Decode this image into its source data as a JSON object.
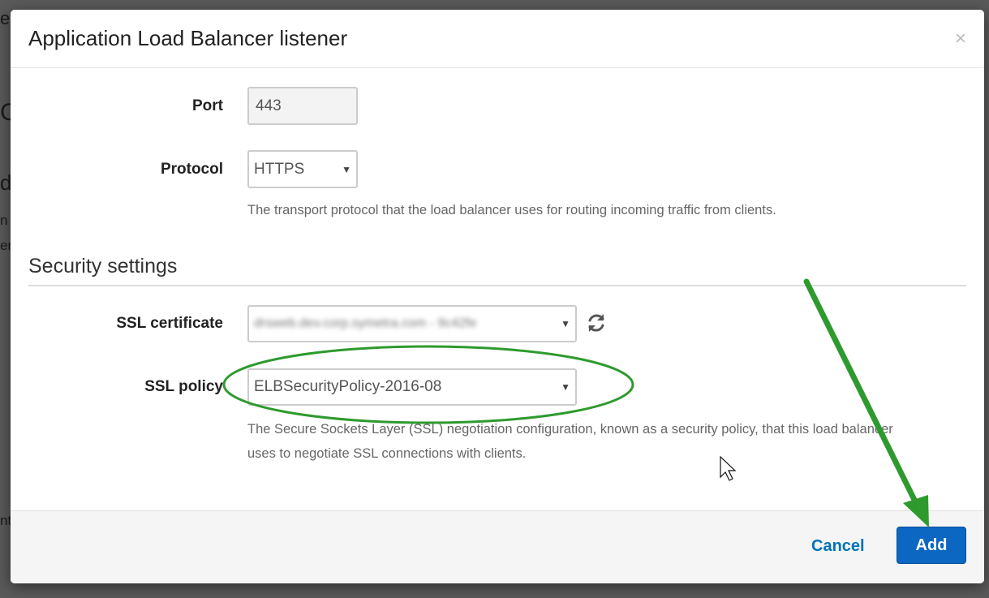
{
  "background": {
    "fragments": [
      "ew",
      "C",
      "d",
      "n",
      "er",
      "nt"
    ]
  },
  "modal": {
    "title": "Application Load Balancer listener",
    "close_label": "×"
  },
  "listener": {
    "port_label": "Port",
    "port_value": "443",
    "protocol_label": "Protocol",
    "protocol_value": "HTTPS",
    "protocol_help": "The transport protocol that the load balancer uses for routing incoming traffic from clients."
  },
  "security": {
    "section_title": "Security settings",
    "ssl_certificate_label": "SSL certificate",
    "ssl_certificate_value": "drsweb.dev.corp.symetra.com - 9c42fe",
    "ssl_policy_label": "SSL policy",
    "ssl_policy_value": "ELBSecurityPolicy-2016-08",
    "ssl_policy_help_line1": "The Secure Sockets Layer (SSL) negotiation configuration, known as a security policy, that this load balancer",
    "ssl_policy_help_line2": "uses to negotiate SSL connections with clients."
  },
  "footer": {
    "cancel_label": "Cancel",
    "add_label": "Add"
  },
  "colors": {
    "annotation_green": "#2e9a2e",
    "primary_button": "#0b67c2",
    "link_blue": "#0073bb"
  },
  "icons": {
    "refresh": "refresh-icon",
    "close": "close-icon",
    "caret": "caret-down-icon",
    "cursor": "mouse-pointer-icon"
  }
}
